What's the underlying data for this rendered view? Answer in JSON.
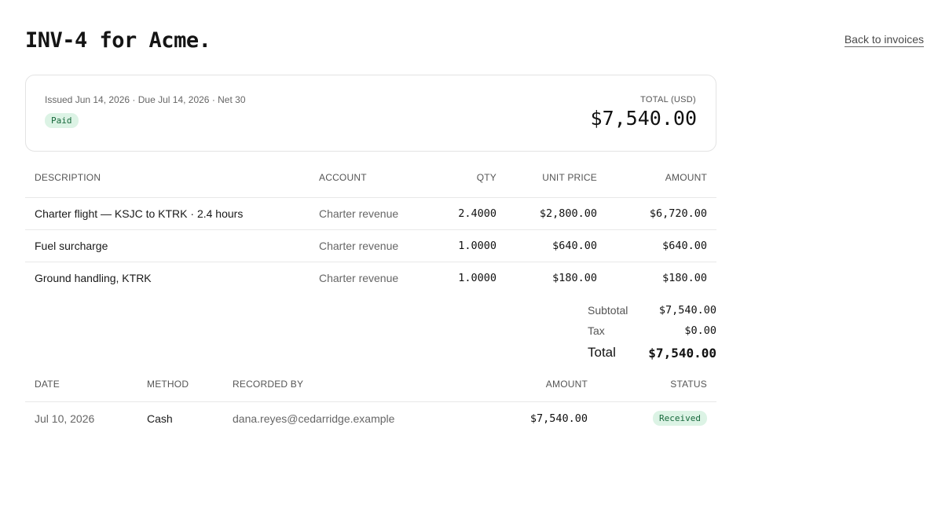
{
  "header": {
    "title": "INV-4 for Acme.",
    "back_link": "Back to invoices"
  },
  "summary": {
    "issued_line": "Issued Jun 14, 2026 · Due Jul 14, 2026 · Net 30",
    "status": "Paid",
    "total_label": "TOTAL (USD)",
    "total_value": "$7,540.00"
  },
  "line_items": {
    "columns": [
      "DESCRIPTION",
      "ACCOUNT",
      "QTY",
      "UNIT PRICE",
      "AMOUNT"
    ],
    "rows": [
      {
        "description": "Charter flight — KSJC to KTRK · 2.4 hours",
        "account": "Charter revenue",
        "qty": "2.4000",
        "unit_price": "$2,800.00",
        "amount": "$6,720.00"
      },
      {
        "description": "Fuel surcharge",
        "account": "Charter revenue",
        "qty": "1.0000",
        "unit_price": "$640.00",
        "amount": "$640.00"
      },
      {
        "description": "Ground handling, KTRK",
        "account": "Charter revenue",
        "qty": "1.0000",
        "unit_price": "$180.00",
        "amount": "$180.00"
      }
    ]
  },
  "totals": {
    "subtotal_label": "Subtotal",
    "subtotal": "$7,540.00",
    "tax_label": "Tax",
    "tax": "$0.00",
    "total_label": "Total",
    "total": "$7,540.00"
  },
  "payments": {
    "columns": [
      "DATE",
      "METHOD",
      "RECORDED BY",
      "AMOUNT",
      "STATUS"
    ],
    "rows": [
      {
        "date": "Jul 10, 2026",
        "method": "Cash",
        "recorded_by": "dana.reyes@cedarridge.example",
        "amount": "$7,540.00",
        "status": "Received"
      }
    ]
  },
  "colors": {
    "badge_bg": "#dcf3e5",
    "badge_text": "#16683b",
    "border": "#e3e3e3"
  }
}
